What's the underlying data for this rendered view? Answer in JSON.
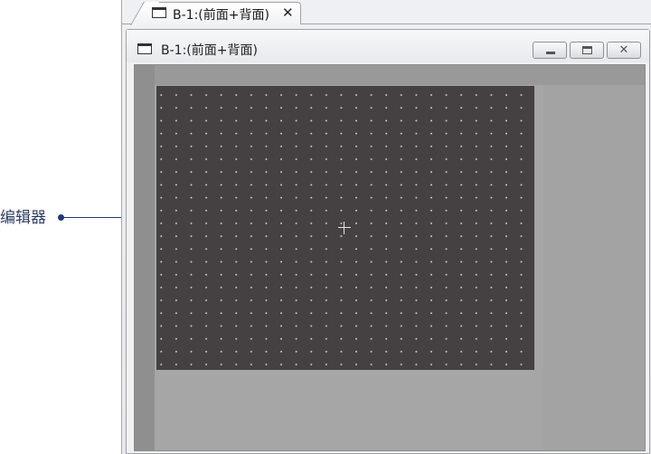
{
  "tab": {
    "label": "B-1:(前面+背面)",
    "close": "✕"
  },
  "window": {
    "title": "B-1:(前面+背面)",
    "controls": {
      "minimize": "minimize",
      "maximize": "maximize",
      "close": "✕"
    }
  },
  "callout": {
    "label": "编辑器"
  },
  "icons": [
    "window-icon",
    "close-icon",
    "minimize-icon",
    "maximize-icon",
    "crosshair-icon"
  ],
  "colors": {
    "canvas": "#454142",
    "grid_dots": "#cfcccc",
    "client_bg": "#a6a6a6",
    "callout": "#1d3a78"
  }
}
